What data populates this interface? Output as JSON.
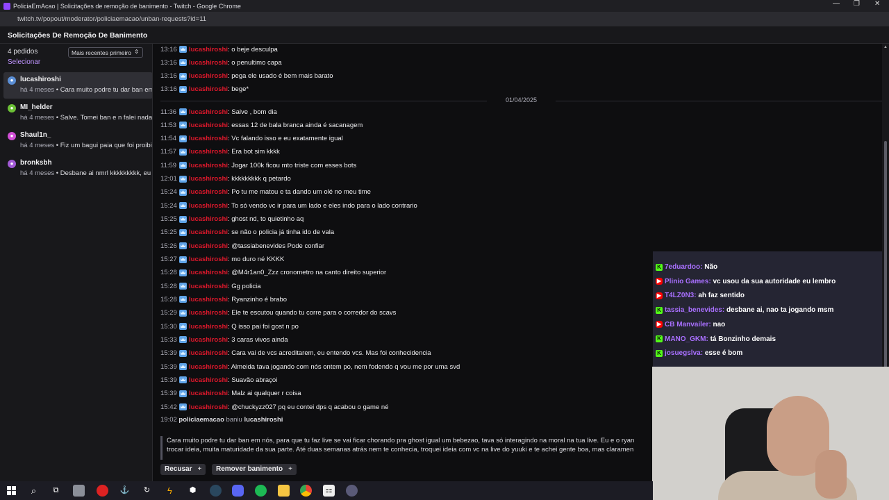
{
  "window": {
    "title": "PoliciaEmAcao | Solicitações de remoção de banimento - Twitch - Google Chrome",
    "url": "twitch.tv/popout/moderator/policiaemacao/unban-requests?id=11",
    "controls": [
      "—",
      "❐",
      "✕"
    ]
  },
  "page": {
    "title": "Solicitações De Remoção De Banimento"
  },
  "sidebar": {
    "count": "4 pedidos",
    "sort": "Mais recentes primeiro",
    "select": "Selecionar",
    "requests": [
      {
        "name": "lucashiroshi",
        "time": "há 4 meses",
        "preview": "Cara muito podre tu dar ban em nós",
        "color": "#5b8fd6",
        "active": true
      },
      {
        "name": "MI_helder",
        "time": "há 4 meses",
        "preview": "Salve. Tomei ban e n falei nada",
        "color": "#6cc036",
        "active": false
      },
      {
        "name": "Shaul1n_",
        "time": "há 4 meses",
        "preview": "Fiz um bagui paia que foi proibido",
        "color": "#d14fd6",
        "active": false
      },
      {
        "name": "bronksbh",
        "time": "há 4 meses",
        "preview": "Desbane ai nmrl kkkkkkkkk, eu",
        "color": "#a25ad6",
        "active": false
      }
    ]
  },
  "chat": {
    "user": "lucashiroshi",
    "before_date": [
      {
        "t": "13:16",
        "msg": ": o beje desculpa"
      },
      {
        "t": "13:16",
        "msg": ": o penultimo capa"
      },
      {
        "t": "13:16",
        "msg": ": pega ele usado é bem mais barato"
      },
      {
        "t": "13:16",
        "msg": ": bege*"
      }
    ],
    "date_divider": "01/04/2025",
    "after_date": [
      {
        "t": "11:36",
        "msg": ": Salve , bom dia"
      },
      {
        "t": "11:53",
        "msg": ": essas 12 de bala branca ainda é sacanagem"
      },
      {
        "t": "11:54",
        "msg": ": Vc falando isso e eu exatamente igual"
      },
      {
        "t": "11:57",
        "msg": ": Era bot sim kkkk"
      },
      {
        "t": "11:59",
        "msg": ": Jogar 100k ficou mto triste com esses bots"
      },
      {
        "t": "12:01",
        "msg": ": kkkkkkkkk q petardo"
      },
      {
        "t": "15:24",
        "msg": ": Po tu me matou e ta dando um olé no meu time"
      },
      {
        "t": "15:24",
        "msg": ": To só vendo vc ir para um lado e eles indo para o lado contrario"
      },
      {
        "t": "15:25",
        "msg": ": ghost nd, to quietinho aq"
      },
      {
        "t": "15:25",
        "msg": ": se não o policia já tinha ido de vala"
      },
      {
        "t": "15:26",
        "msg": ": @tassiabenevides Pode confiar"
      },
      {
        "t": "15:27",
        "msg": ": mo duro né KKKK"
      },
      {
        "t": "15:28",
        "msg": ": @M4r1an0_Zzz cronometro na canto direito superior"
      },
      {
        "t": "15:28",
        "msg": ": Gg policia"
      },
      {
        "t": "15:28",
        "msg": ": Ryanzinho é brabo"
      },
      {
        "t": "15:29",
        "msg": ": Ele te escutou quando tu corre para o corredor do scavs"
      },
      {
        "t": "15:30",
        "msg": ": Q isso pai foi gost n po"
      },
      {
        "t": "15:33",
        "msg": ": 3 caras vivos ainda"
      },
      {
        "t": "15:39",
        "msg": ": Cara vai de vcs acreditarem, eu entendo vcs. Mas foi conhecidencia"
      },
      {
        "t": "15:39",
        "msg": ": Almeida tava jogando com nós ontem po, nem fodendo q vou me por uma svd"
      },
      {
        "t": "15:39",
        "msg": ": Suavão abraçoi"
      },
      {
        "t": "15:39",
        "msg": ": Malz ai qualquer r coisa"
      },
      {
        "t": "15:42",
        "msg": ": @chuckyzz027 pq eu contei dps q acabou o game né"
      }
    ],
    "ban": {
      "t": "19:02",
      "mod": "policiaemacao",
      "action": "baniu",
      "target": "lucashiroshi"
    }
  },
  "request_message": {
    "line1": "Cara muito podre tu dar ban em nós, para que tu faz live se vai ficar chorando pra ghost igual um bebezao, tava só interagindo na moral na tua live. Eu e o ryan",
    "line2": "trocar ideia, muita maturidade da sua parte. Até duas semanas atrás nem te conhecia, troquei ideia com vc na live do yuuki e te achei gente boa, mas claramen"
  },
  "actions": {
    "deny": "Recusar",
    "unban": "Remover banimento",
    "plus": "+"
  },
  "overlay_chat": [
    {
      "platform": "kick",
      "name": "7eduardoo",
      "msg": "Não"
    },
    {
      "platform": "youtube",
      "name": "Plinio Games",
      "msg": "vc usou da sua autoridade eu lembro"
    },
    {
      "platform": "youtube",
      "name": "T4LZ0N3",
      "msg": "ah faz sentido"
    },
    {
      "platform": "kick",
      "name": "tassia_benevides",
      "msg": "desbane ai, nao ta jogando msm"
    },
    {
      "platform": "youtube",
      "name": "CB Manvailer",
      "msg": "nao"
    },
    {
      "platform": "kick",
      "name": "MANO_GKM",
      "msg": "tá Bonzinho demais"
    },
    {
      "platform": "kick",
      "name": "josuegslva",
      "msg": "esse é bom"
    }
  ],
  "taskbar": {
    "icons": [
      "windows-start",
      "search",
      "task-view",
      "file-app",
      "record-app",
      "app-a",
      "app-b",
      "app-c",
      "app-d",
      "steam",
      "discord",
      "spotify",
      "file-explorer",
      "chrome",
      "app-e",
      "app-f"
    ]
  }
}
